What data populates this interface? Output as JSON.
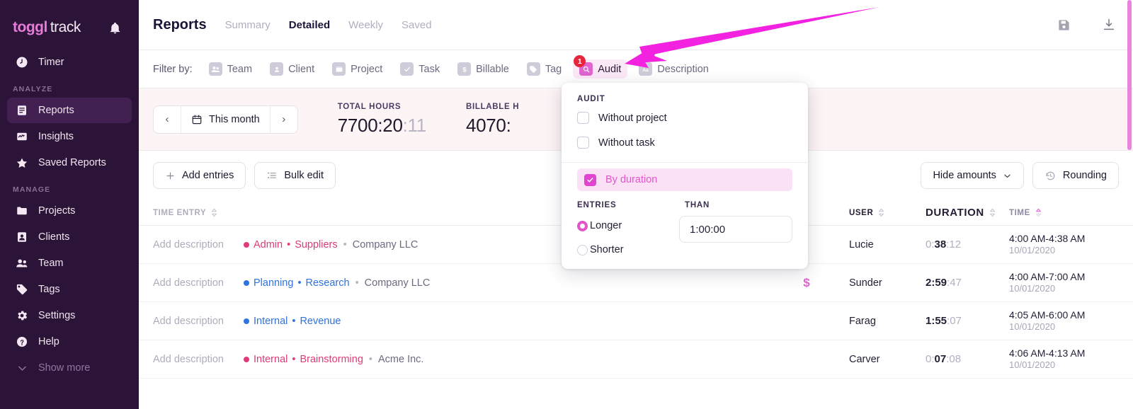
{
  "brand": {
    "primary": "toggl",
    "secondary": "track",
    "accent": "#e57cd8"
  },
  "sidebar": {
    "top_items": [
      {
        "label": "Timer",
        "icon": "clock-icon"
      }
    ],
    "groups": [
      {
        "label": "ANALYZE",
        "items": [
          {
            "label": "Reports",
            "icon": "report-icon",
            "active": true
          },
          {
            "label": "Insights",
            "icon": "insights-icon",
            "active": false
          },
          {
            "label": "Saved Reports",
            "icon": "star-icon",
            "active": false
          }
        ]
      },
      {
        "label": "MANAGE",
        "items": [
          {
            "label": "Projects",
            "icon": "folder-icon",
            "active": false
          },
          {
            "label": "Clients",
            "icon": "client-icon",
            "active": false
          },
          {
            "label": "Team",
            "icon": "team-icon",
            "active": false
          },
          {
            "label": "Tags",
            "icon": "tag-icon",
            "active": false
          },
          {
            "label": "Settings",
            "icon": "gear-icon",
            "active": false
          },
          {
            "label": "Help",
            "icon": "help-icon",
            "active": false
          }
        ]
      }
    ],
    "show_more": {
      "label": "Show more",
      "icon": "chevron-down-icon"
    },
    "bell": "bell-icon"
  },
  "header": {
    "title": "Reports",
    "tabs": [
      {
        "label": "Summary",
        "active": false
      },
      {
        "label": "Detailed",
        "active": true
      },
      {
        "label": "Weekly",
        "active": false
      },
      {
        "label": "Saved",
        "active": false
      }
    ],
    "actions": [
      {
        "name": "save-report-button",
        "icon": "floppy-disk-icon"
      },
      {
        "name": "download-button",
        "icon": "download-icon"
      }
    ]
  },
  "filter_bar": {
    "label": "Filter by:",
    "chips": [
      {
        "label": "Team",
        "icon": "team-icon",
        "active": false,
        "badge": null
      },
      {
        "label": "Client",
        "icon": "client-icon",
        "active": false,
        "badge": null
      },
      {
        "label": "Project",
        "icon": "folder-icon",
        "active": false,
        "badge": null
      },
      {
        "label": "Task",
        "icon": "check-icon",
        "active": false,
        "badge": null
      },
      {
        "label": "Billable",
        "icon": "dollar-icon",
        "active": false,
        "badge": null
      },
      {
        "label": "Tag",
        "icon": "tag-icon",
        "active": false,
        "badge": null
      },
      {
        "label": "Audit",
        "icon": "magnifier-icon",
        "active": true,
        "badge": "1"
      },
      {
        "label": "Description",
        "icon": "text-aa-icon",
        "active": false,
        "badge": null
      }
    ]
  },
  "summary": {
    "date_range": {
      "label": "This month",
      "prev": "‹",
      "next": "›",
      "icon": "calendar-icon"
    },
    "stats": [
      {
        "label": "TOTAL HOURS",
        "main": "7700:20",
        "seconds": ":11"
      },
      {
        "label": "BILLABLE H",
        "main": "4070:",
        "seconds": ""
      }
    ]
  },
  "action_bar": {
    "left_buttons": [
      {
        "label": "Add entries",
        "icon": "plus-icon"
      },
      {
        "label": "Bulk edit",
        "icon": "list-icon"
      }
    ],
    "right_buttons": [
      {
        "label": "Hide amounts",
        "icon": "chevron-down-icon"
      },
      {
        "label": "Rounding",
        "icon": "rounding-icon"
      }
    ]
  },
  "table": {
    "headers": [
      {
        "label": "TIME ENTRY",
        "sortable": true,
        "sorted": false
      },
      {
        "label": "USER",
        "sortable": true,
        "sorted": false
      },
      {
        "label": "DURATION",
        "sortable": true,
        "sorted": false
      },
      {
        "label": "TIME",
        "sortable": true,
        "sorted": true
      }
    ],
    "rows": [
      {
        "entry_placeholder": "Add description",
        "project": "Admin",
        "task": "Suppliers",
        "client": "Company LLC",
        "color": "#e03a7a",
        "color_class": "pj-pink",
        "billable": false,
        "user": "Lucie",
        "dur_lead": "0:",
        "dur_main": "38",
        "dur_sec": ":12",
        "time": "4:00 AM-4:38 AM",
        "date": "10/01/2020"
      },
      {
        "entry_placeholder": "Add description",
        "project": "Planning",
        "task": "Research",
        "client": "Company LLC",
        "color": "#2f72e0",
        "color_class": "pj-blue",
        "billable": true,
        "user": "Sunder",
        "dur_lead": "",
        "dur_main": "2:59",
        "dur_sec": ":47",
        "time": "4:00 AM-7:00 AM",
        "date": "10/01/2020"
      },
      {
        "entry_placeholder": "Add description",
        "project": "Internal",
        "task": "Revenue",
        "client": "",
        "color": "#2f72e0",
        "color_class": "pj-blue",
        "billable": false,
        "user": "Farag",
        "dur_lead": "",
        "dur_main": "1:55",
        "dur_sec": ":07",
        "time": "4:05 AM-6:00 AM",
        "date": "10/01/2020"
      },
      {
        "entry_placeholder": "Add description",
        "project": "Internal",
        "task": "Brainstorming",
        "client": "Acme Inc.",
        "color": "#e03a7a",
        "color_class": "pj-pink",
        "billable": false,
        "user": "Carver",
        "dur_lead": "0:",
        "dur_main": "07",
        "dur_sec": ":08",
        "time": "4:06 AM-4:13 AM",
        "date": "10/01/2020"
      }
    ]
  },
  "audit_panel": {
    "title": "AUDIT",
    "checkboxes": [
      {
        "label": "Without project",
        "checked": false
      },
      {
        "label": "Without task",
        "checked": false
      }
    ],
    "duration_toggle": {
      "label": "By duration",
      "checked": true
    },
    "col_entries_label": "ENTRIES",
    "col_than_label": "THAN",
    "radios": [
      {
        "label": "Longer",
        "selected": true
      },
      {
        "label": "Shorter",
        "selected": false
      }
    ],
    "duration_value": "1:00:00"
  },
  "annotation": {
    "type": "arrow",
    "color": "#f222e0",
    "points_to": "Audit"
  },
  "scrollbar": {
    "color": "#e884e0"
  }
}
